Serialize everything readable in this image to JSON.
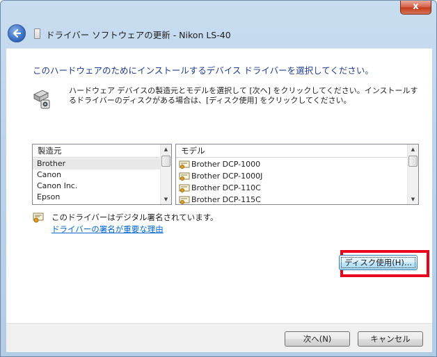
{
  "window": {
    "close_symbol": "x",
    "title": "ドライバー ソフトウェアの更新 - Nikon LS-40"
  },
  "main": {
    "heading": "このハードウェアのためにインストールするデバイス ドライバーを選択してください。",
    "description": "ハードウェア デバイスの製造元とモデルを選択して [次へ] をクリックしてください。インストールするドライバーのディスクがある場合は、[ディスク使用] をクリックしてください。",
    "manufacturer_list": {
      "header": "製造元",
      "items": [
        "Brother",
        "Canon",
        "Canon Inc.",
        "Epson"
      ]
    },
    "model_list": {
      "header": "モデル",
      "items": [
        "Brother DCP-1000",
        "Brother DCP-1000J",
        "Brother DCP-110C",
        "Brother DCP-115C"
      ]
    },
    "signature_text": "このドライバーはデジタル署名されています。",
    "signature_link": "ドライバーの署名が重要な理由",
    "have_disk_button": "ディスク使用(H)..."
  },
  "footer": {
    "next_button": "次へ(N)",
    "cancel_button": "キャンセル"
  },
  "icons": {
    "back": "back-arrow-icon",
    "hardware": "scanner-hardware-icon",
    "signature": "certificate-icon",
    "model": "driver-certificate-icon"
  },
  "colors": {
    "heading": "#1f3d8c",
    "link": "#0066cc",
    "highlight": "#e8001c"
  }
}
